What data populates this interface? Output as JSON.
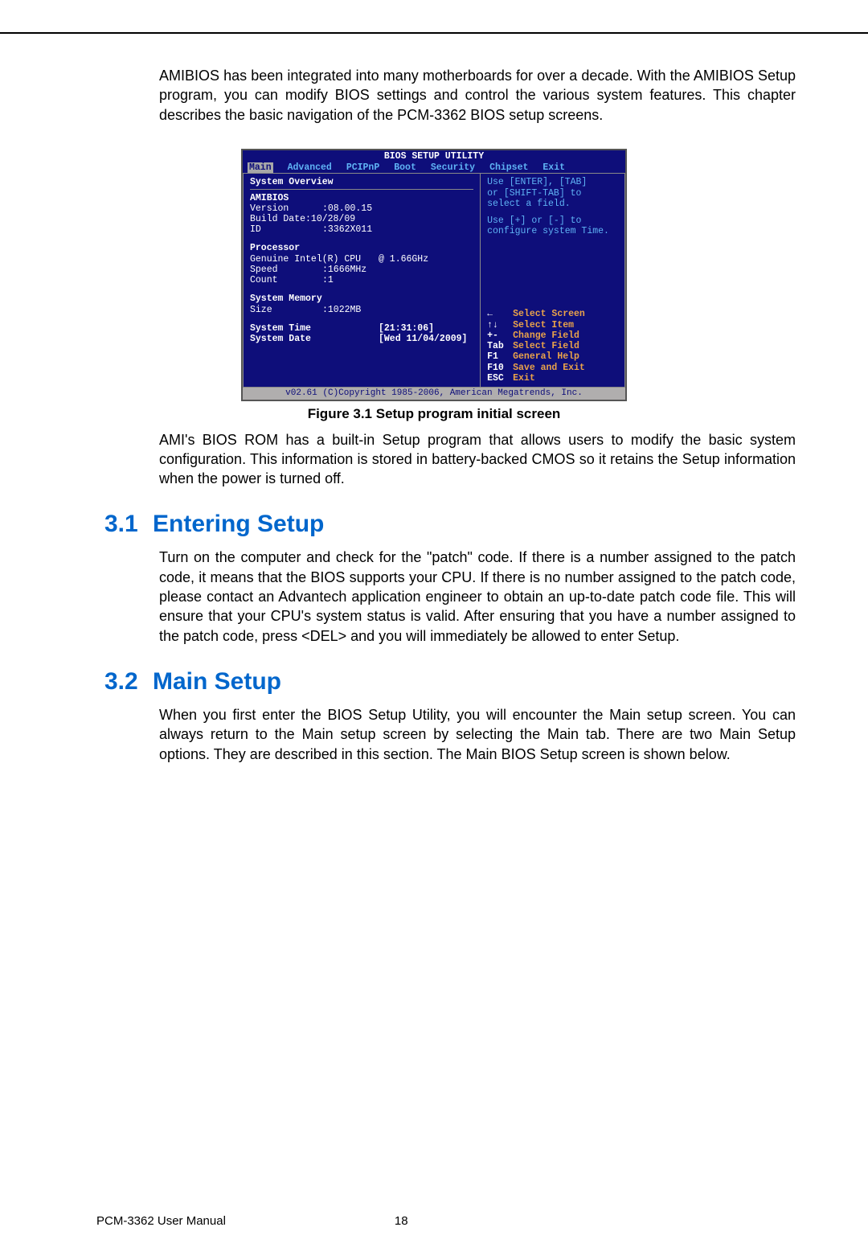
{
  "intro_para": "AMIBIOS has been integrated into many motherboards for over a decade. With the AMIBIOS Setup program, you can modify BIOS settings and control the various system features. This chapter describes the basic navigation of the PCM-3362 BIOS setup screens.",
  "bios": {
    "title": "BIOS SETUP UTILITY",
    "tabs": [
      "Main",
      "Advanced",
      "PCIPnP",
      "Boot",
      "Security",
      "Chipset",
      "Exit"
    ],
    "overview_label": "System Overview",
    "amibios_label": "AMIBIOS",
    "version_label": "Version",
    "version_value": ":08.00.15",
    "builddate_label": "Build Date:10/28/09",
    "id_label": "ID",
    "id_value": ":3362X011",
    "processor_label": "Processor",
    "processor_name": "Genuine Intel(R) CPU",
    "processor_freq": "@ 1.66GHz",
    "speed_label": "Speed",
    "speed_value": ":1666MHz",
    "count_label": "Count",
    "count_value": ":1",
    "sysmem_label": "System Memory",
    "size_label": "Size",
    "size_value": ":1022MB",
    "systime_label": "System Time",
    "systime_value": "[21:31:06]",
    "sysdate_label": "System Date",
    "sysdate_value": "[Wed 11/04/2009]",
    "help_line1": "Use [ENTER], [TAB]",
    "help_line2": "or [SHIFT-TAB] to",
    "help_line3": "select a field.",
    "help_line4": "Use [+] or [-] to",
    "help_line5": "configure system Time.",
    "keys": {
      "k1": "←",
      "d1": "Select Screen",
      "k2": "↑↓",
      "d2": "Select Item",
      "k3": "+-",
      "d3": "Change Field",
      "k4": "Tab",
      "d4": "Select Field",
      "k5": "F1",
      "d5": "General Help",
      "k6": "F10",
      "d6": "Save and Exit",
      "k7": "ESC",
      "d7": "Exit"
    },
    "footer": "v02.61 (C)Copyright 1985-2006, American Megatrends, Inc."
  },
  "figure_caption": "Figure 3.1 Setup program initial screen",
  "post_fig_para": "AMI's BIOS ROM has a built-in Setup program that allows users to modify the basic system configuration. This information is stored in battery-backed CMOS so it retains the Setup information when the power is turned off.",
  "sec31_num": "3.1",
  "sec31_title": "Entering Setup",
  "sec31_para": "Turn on the computer and check for the \"patch\" code. If there is a number assigned to the patch code, it means that the BIOS supports your CPU. If there is no number assigned to the patch code, please contact an Advantech application engineer to obtain an up-to-date patch code file. This will ensure that your CPU's system status is valid. After ensuring that you have a number assigned to the patch code, press <DEL> and you will immediately be allowed to enter Setup.",
  "sec32_num": "3.2",
  "sec32_title": "Main Setup",
  "sec32_para": "When you first enter the BIOS Setup Utility, you will encounter the Main setup screen. You can always return to the Main setup screen by selecting the Main tab. There are two Main Setup options. They are described in this section. The Main BIOS Setup screen is shown below.",
  "footer_left": "PCM-3362 User Manual",
  "footer_page": "18"
}
